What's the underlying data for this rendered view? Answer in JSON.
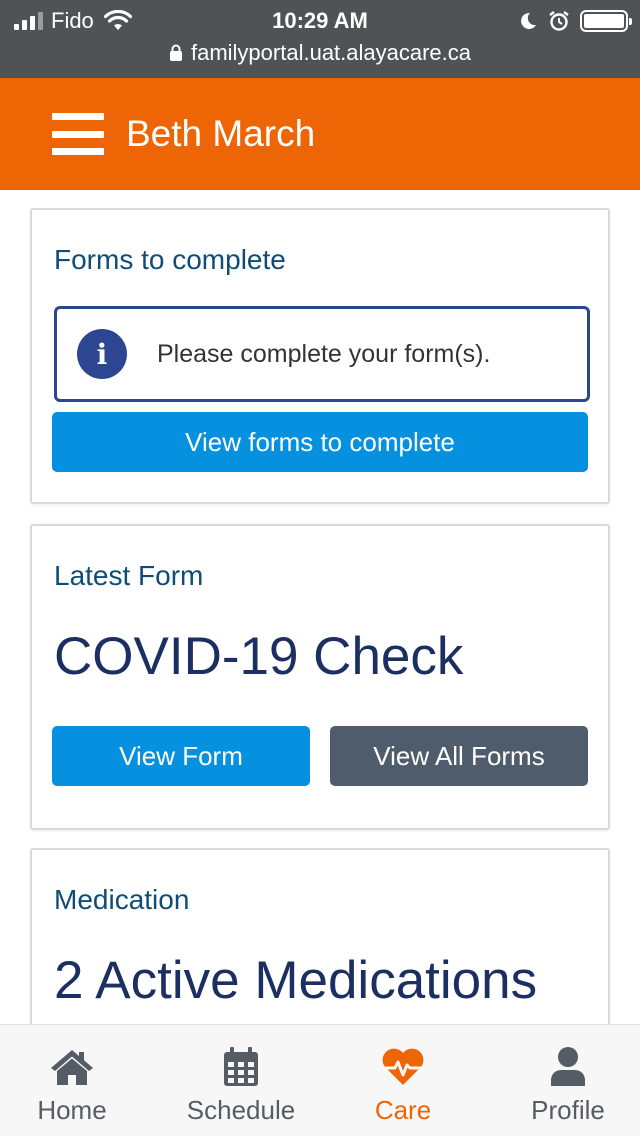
{
  "status_bar": {
    "carrier": "Fido",
    "time": "10:29 AM",
    "url": "familyportal.uat.alayacare.ca"
  },
  "header": {
    "title": "Beth March"
  },
  "cards": {
    "forms": {
      "title": "Forms to complete",
      "alert_text": "Please complete your form(s).",
      "button_label": "View forms to complete"
    },
    "latest_form": {
      "title": "Latest Form",
      "form_name": "COVID-19 Check",
      "view_form_label": "View Form",
      "view_all_label": "View All Forms"
    },
    "medication": {
      "title": "Medication",
      "summary": "2 Active Medications"
    }
  },
  "bottom_nav": {
    "items": [
      {
        "label": "Home",
        "icon": "home-icon"
      },
      {
        "label": "Schedule",
        "icon": "calendar-icon"
      },
      {
        "label": "Care",
        "icon": "heartbeat-icon",
        "active": true
      },
      {
        "label": "Profile",
        "icon": "user-icon"
      }
    ]
  },
  "colors": {
    "brand_orange": "#ee6506",
    "primary_blue": "#0691e0",
    "secondary_gray": "#4f5c6b",
    "heading_blue": "#0f4c77",
    "alert_navy": "#2c4692"
  }
}
